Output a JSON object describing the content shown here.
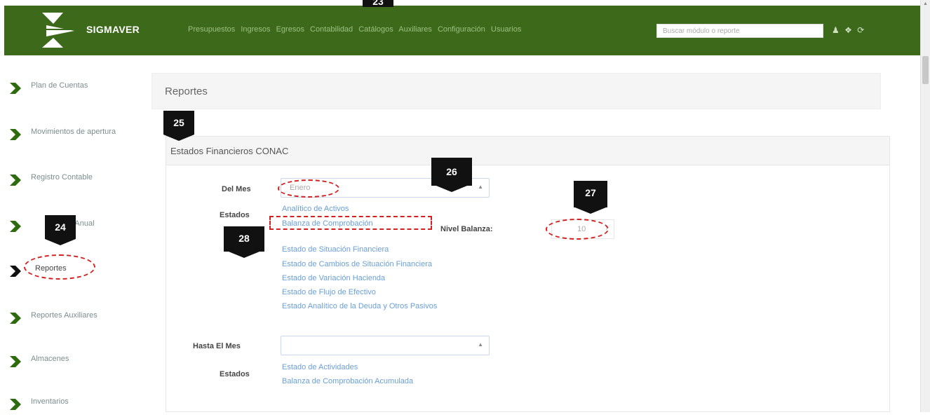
{
  "header": {
    "brand": "SIGMAVER",
    "nav": [
      "Presupuestos",
      "Ingresos",
      "Egresos",
      "Contabilidad",
      "Catálogos",
      "Auxiliares",
      "Configuración",
      "Usuarios"
    ],
    "search_placeholder": "Buscar módulo o reporte",
    "icons": [
      "user-icon",
      "help-icon",
      "logout-icon"
    ]
  },
  "sidebar": {
    "items": [
      {
        "label": "Plan de Cuentas"
      },
      {
        "label": "Movimientos de apertura"
      },
      {
        "label": "Registro Contable"
      },
      {
        "label": "Cierre Anual"
      },
      {
        "label": "Reportes",
        "active": true
      },
      {
        "label": "Reportes Auxiliares"
      },
      {
        "label": "Almacenes"
      },
      {
        "label": "Inventarios"
      }
    ]
  },
  "main": {
    "panel_title": "Reportes",
    "section_title": "Estados Financieros CONAC",
    "del_mes_label": "Del Mes",
    "del_mes_value": "Enero",
    "estados_label": "Estados",
    "estados_links": [
      "Analítico de Activos",
      "Balanza de Comprobación",
      "Estado de Situación Financiera",
      "Estado de Cambios de Situación Financiera",
      "Estado de Variación Hacienda",
      "Estado de Flujo de Efectivo",
      "Estado Analítico de la Deuda y Otros Pasivos"
    ],
    "nivel_balanza_label": "Nivel Balanza:",
    "nivel_balanza_value": "10",
    "hasta_mes_label": "Hasta El Mes",
    "hasta_mes_value": "",
    "estados2_label": "Estados",
    "estados2_links": [
      "Estado de Actividades",
      "Balanza de Comprobación Acumulada"
    ]
  },
  "callouts": [
    "23",
    "24",
    "25",
    "26",
    "27",
    "28"
  ],
  "colors": {
    "header_bg": "#3c6a1a",
    "link": "#6a9fd6",
    "highlight": "#d32020"
  }
}
